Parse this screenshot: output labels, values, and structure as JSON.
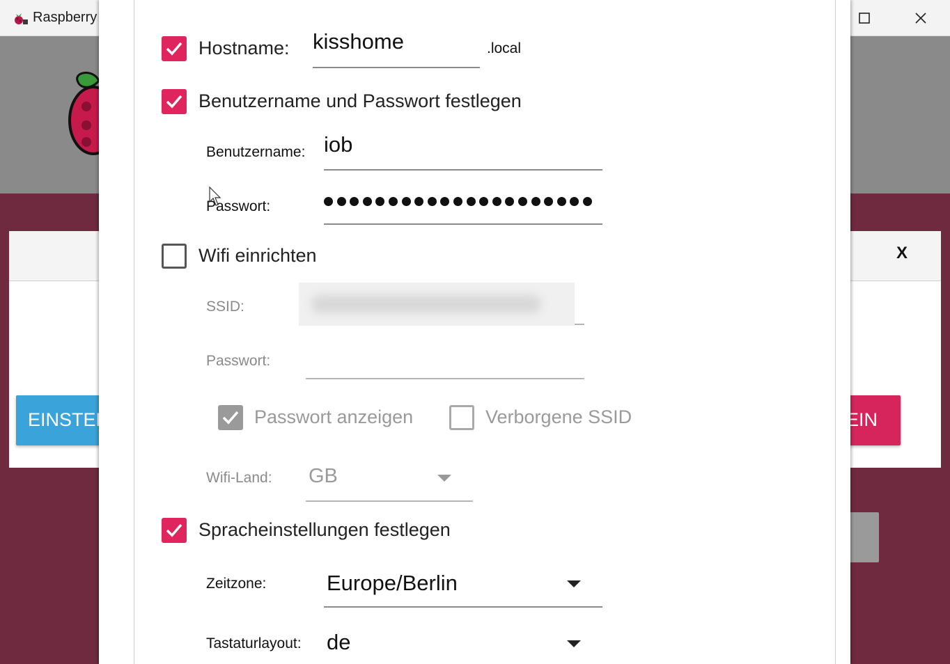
{
  "app": {
    "title": "Raspberry",
    "icon": "raspberry-icon",
    "panel_close": "X",
    "left_button": "EINSTEL",
    "right_button": "EIN"
  },
  "window_controls": [
    "maximize-icon",
    "close-icon"
  ],
  "settings": {
    "hostname": {
      "checked": true,
      "label": "Hostname:",
      "value": "kisshome",
      "suffix": ".local"
    },
    "credentials": {
      "checked": true,
      "label": "Benutzername und Passwort festlegen",
      "username_label": "Benutzername:",
      "username_value": "iob",
      "password_label": "Passwort:",
      "password_mask_count": 21
    },
    "wifi": {
      "checked": false,
      "label": "Wifi einrichten",
      "ssid_label": "SSID:",
      "password_label": "Passwort:",
      "show_password": {
        "checked": true,
        "label": "Passwort anzeigen"
      },
      "hidden_ssid": {
        "checked": false,
        "label": "Verborgene SSID"
      },
      "country_label": "Wifi-Land:",
      "country_value": "GB"
    },
    "locale": {
      "checked": true,
      "label": "Spracheinstellungen festlegen",
      "timezone_label": "Zeitzone:",
      "timezone_value": "Europe/Berlin",
      "keyboard_label": "Tastaturlayout:",
      "keyboard_value": "de"
    }
  },
  "colors": {
    "accent": "#e0245e",
    "blue_button": "#3aa3d9",
    "background": "#6f2a3f"
  }
}
